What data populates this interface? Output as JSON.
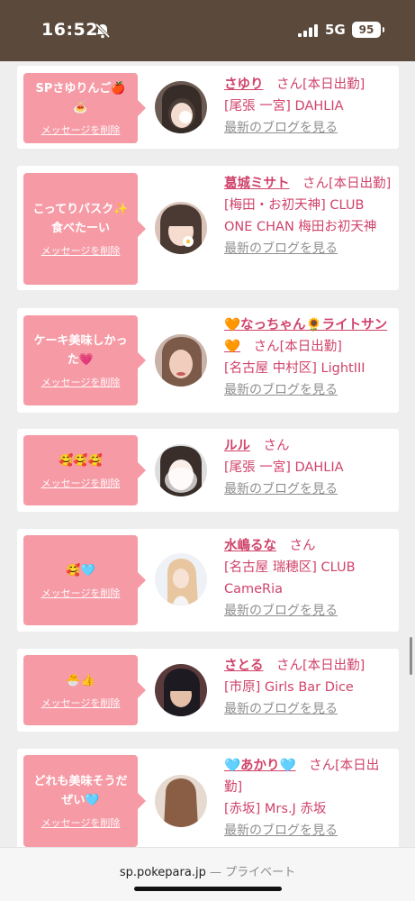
{
  "status_bar": {
    "time": "16:52",
    "network": "5G",
    "battery": "95"
  },
  "browser": {
    "url": "sp.pokepara.jp",
    "mode": "— プライベート"
  },
  "delete_label": "メッセージを削除",
  "blog_label": "最新のブログを見る",
  "honorific": "さん",
  "cards": [
    {
      "message": "SPさゆりんご🍎🍝",
      "name": "さゆり",
      "after_san": "[本日出勤]",
      "shop": "[尾張 一宮] DAHLIA"
    },
    {
      "message": "こってりバスク✨食べたーい",
      "name": "葛城ミサト",
      "after_san": "[本日出勤]",
      "shop": "[梅田・お初天神] CLUB ONE CHAN 梅田お初天神"
    },
    {
      "message": "ケーキ美味しかった💗",
      "name": "🧡なっちゃん🌻ライトサン🧡",
      "after_san": "[本日出勤]",
      "shop": "[名古屋 中村区] LightIII"
    },
    {
      "message": "🥰🥰🥰",
      "name": "ルル",
      "after_san": "",
      "shop": "[尾張 一宮] DAHLIA"
    },
    {
      "message": "🥰🩵",
      "name": "水嶋るな",
      "after_san": "",
      "shop": "[名古屋 瑞穂区] CLUB CameRia"
    },
    {
      "message": "🐣👍",
      "name": "さとる",
      "after_san": "[本日出勤]",
      "shop": "[市原] Girls Bar Dice"
    },
    {
      "message": "どれも美味そうだぜい🩵",
      "name": "🩵あかり🩵",
      "after_san": "[本日出勤]",
      "shop": "[赤坂] Mrs.J 赤坂"
    }
  ],
  "colors": {
    "status_bar": "#5b4a3c",
    "bubble": "#f69ba6",
    "link": "#d0436b",
    "blog_link": "#8f8f8f"
  }
}
